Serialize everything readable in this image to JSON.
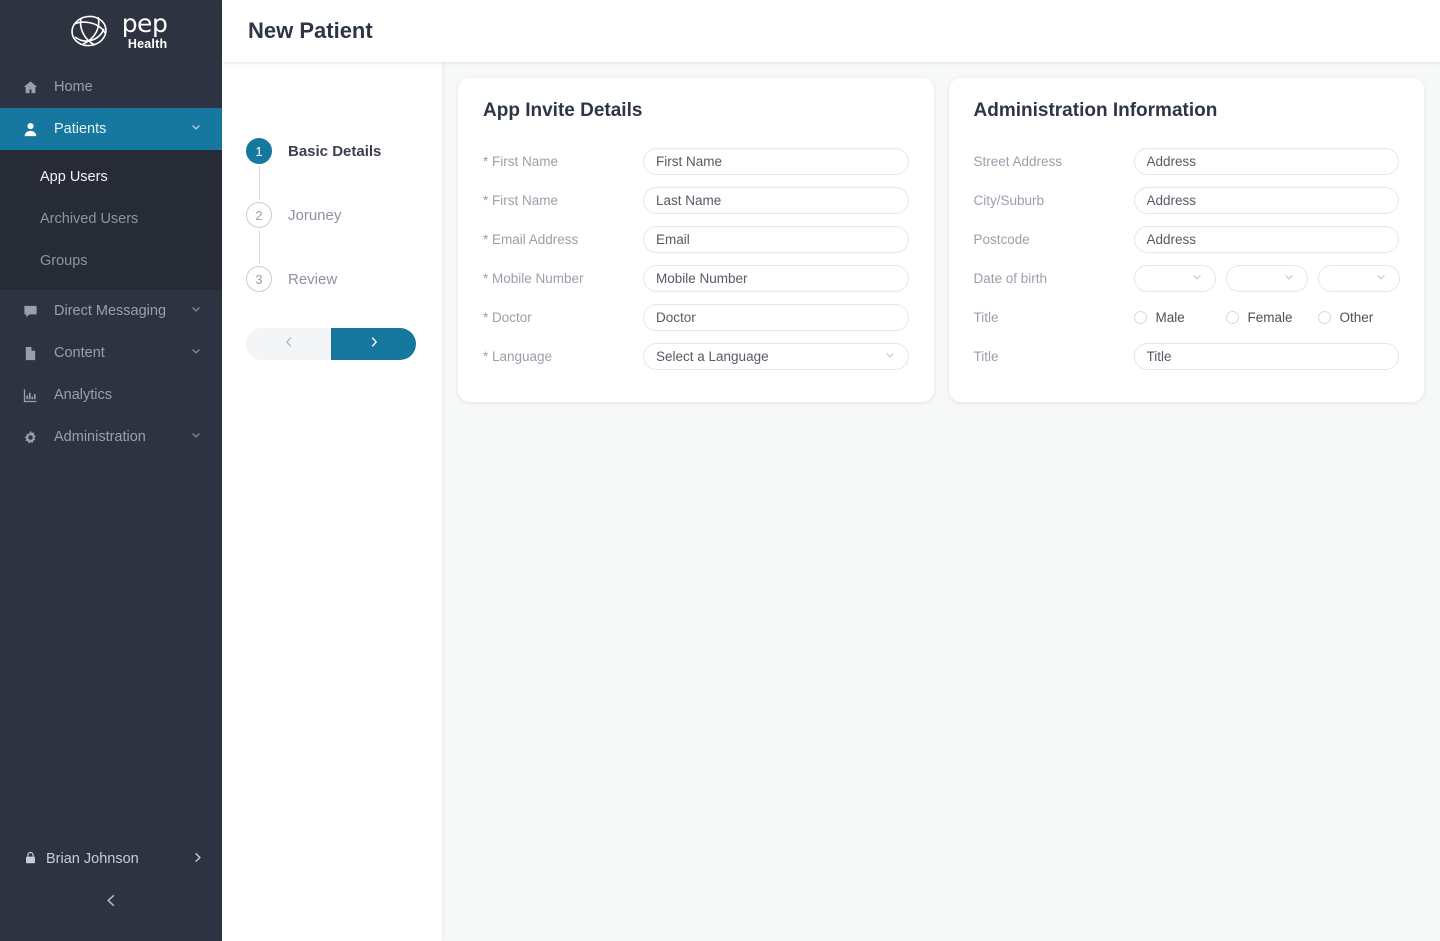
{
  "brand": {
    "name_primary": "pep",
    "name_secondary": "Health",
    "accent_color": "#17789f",
    "sidebar_color": "#2d3340"
  },
  "header": {
    "title": "New Patient"
  },
  "sidebar": {
    "items": [
      {
        "label": "Home",
        "icon": "home-icon",
        "active": false,
        "expandable": false
      },
      {
        "label": "Patients",
        "icon": "user-icon",
        "active": true,
        "expandable": true
      },
      {
        "label": "Direct Messaging",
        "icon": "chat-icon",
        "active": false,
        "expandable": true
      },
      {
        "label": "Content",
        "icon": "document-icon",
        "active": false,
        "expandable": true
      },
      {
        "label": "Analytics",
        "icon": "bar-chart-icon",
        "active": false,
        "expandable": false
      },
      {
        "label": "Administration",
        "icon": "gear-icon",
        "active": false,
        "expandable": true
      }
    ],
    "subitems": [
      {
        "label": "App Users",
        "active": true
      },
      {
        "label": "Archived Users",
        "active": false
      },
      {
        "label": "Groups",
        "active": false
      }
    ],
    "user": {
      "name": "Brian Johnson",
      "icon": "lock-icon",
      "chevron": "chevron-right-icon"
    },
    "collapse_icon": "chevron-left-icon"
  },
  "stepper": {
    "steps": [
      {
        "number": "1",
        "label": "Basic Details",
        "active": true
      },
      {
        "number": "2",
        "label": "Joruney",
        "active": false
      },
      {
        "number": "3",
        "label": "Review",
        "active": false
      }
    ],
    "prev_icon": "chevron-left-icon",
    "next_icon": "chevron-right-icon"
  },
  "cards": [
    {
      "title": "App Invite Details",
      "fields": [
        {
          "label": "* First Name",
          "type": "text",
          "placeholder": "First Name",
          "value": ""
        },
        {
          "label": "* First Name",
          "type": "text",
          "placeholder": "Last Name",
          "value": ""
        },
        {
          "label": "* Email Address",
          "type": "text",
          "placeholder": "Email",
          "value": ""
        },
        {
          "label": "* Mobile Number",
          "type": "text",
          "placeholder": "Mobile Number",
          "value": ""
        },
        {
          "label": "* Doctor",
          "type": "text",
          "placeholder": "Doctor",
          "value": ""
        },
        {
          "label": "* Language",
          "type": "select",
          "selected": "Select a Language"
        }
      ]
    },
    {
      "title": "Administration Information",
      "fields": [
        {
          "label": "Street Address",
          "type": "text",
          "placeholder": "Address",
          "value": ""
        },
        {
          "label": "City/Suburb",
          "type": "text",
          "placeholder": "Address",
          "value": ""
        },
        {
          "label": "Postcode",
          "type": "text",
          "placeholder": "Address",
          "value": ""
        },
        {
          "label": "Date of birth",
          "type": "date3",
          "selects": [
            "",
            "",
            ""
          ]
        },
        {
          "label": "Title",
          "type": "radio",
          "options": [
            "Male",
            "Female",
            "Other"
          ],
          "selected": ""
        },
        {
          "label": "Title",
          "type": "text",
          "placeholder": "Title",
          "value": ""
        }
      ]
    }
  ]
}
